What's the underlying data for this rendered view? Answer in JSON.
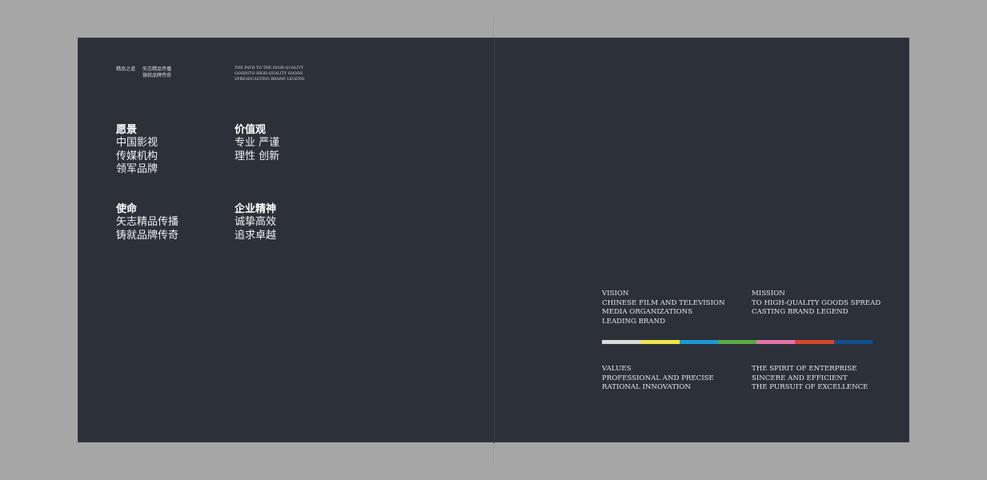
{
  "left_page": {
    "tagline": {
      "label": "精品之道",
      "lines": [
        "矢志精品传播",
        "铸就品牌传奇"
      ],
      "english": [
        "THE PATH TO THE HIGH-QUALITY",
        "GOODSTO HIGH-QUALITY GOODS",
        "SPREADCASTING BRAND LEGEND"
      ]
    },
    "vision": {
      "title": "愿景",
      "lines": [
        "中国影视",
        "传媒机构",
        "领军品牌"
      ]
    },
    "values": {
      "title": "价值观",
      "lines": [
        "专业 严谨",
        "理性 创新"
      ]
    },
    "mission": {
      "title": "使命",
      "lines": [
        "矢志精品传播",
        "铸就品牌传奇"
      ]
    },
    "spirit": {
      "title": "企业精神",
      "lines": [
        "诚挚高效",
        "追求卓越"
      ]
    }
  },
  "right_page": {
    "vision": {
      "lines": [
        "VISION",
        "CHINESE FILM AND TELEVISION",
        "MEDIA ORGANIZATIONS",
        "LEADING BRAND"
      ]
    },
    "mission": {
      "lines": [
        "MISSION",
        "TO HIGH-QUALITY GOODS SPREAD",
        "CASTING BRAND LEGEND"
      ]
    },
    "values": {
      "lines": [
        "VALUES",
        "PROFESSIONAL AND PRECISE",
        "RATIONAL INNOVATION"
      ]
    },
    "spirit": {
      "lines": [
        "THE SPIRIT OF ENTERPRISE",
        "SINCERE AND EFFICIENT",
        "THE PURSUIT OF EXCELLENCE"
      ]
    },
    "color_bar": [
      "#d9d9d9",
      "#f1e64b",
      "#1a9bd7",
      "#5aaa46",
      "#e273a8",
      "#d9452e",
      "#124d8b"
    ]
  },
  "colors": {
    "background": "#2c3039",
    "surround": "#a6a6a6",
    "text": "#ffffff"
  }
}
